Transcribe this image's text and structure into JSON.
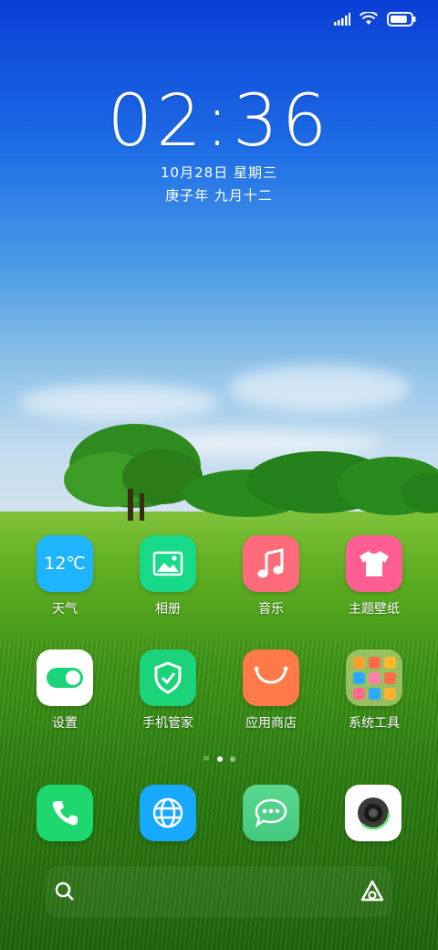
{
  "lockscreen": {
    "time": "02:36",
    "date": "10月28日 星期三",
    "lunar": "庚子年 九月十二"
  },
  "status": {
    "signal_icon": "signal-icon",
    "wifi_icon": "wifi-icon",
    "battery_icon": "battery-icon",
    "battery_level": 0.85
  },
  "apps": [
    {
      "name": "weather",
      "label": "天气",
      "icon_text": "12℃",
      "color": "#1eb4ff"
    },
    {
      "name": "photos",
      "label": "相册",
      "color": "#17d98a"
    },
    {
      "name": "music",
      "label": "音乐",
      "color": "#ff6b7b"
    },
    {
      "name": "themes",
      "label": "主题壁纸",
      "color": "#ff5e95"
    },
    {
      "name": "settings",
      "label": "设置",
      "color": "#ffffff"
    },
    {
      "name": "security",
      "label": "手机管家",
      "color": "#1bd47a"
    },
    {
      "name": "app-store",
      "label": "应用商店",
      "color": "#ff7a48"
    },
    {
      "name": "system-tools",
      "label": "系统工具",
      "color": "#9bc95a"
    }
  ],
  "dock": [
    {
      "name": "phone",
      "color": "#1ed86f"
    },
    {
      "name": "browser",
      "color": "#16a9ff"
    },
    {
      "name": "messages",
      "color": "#4fd38f"
    },
    {
      "name": "camera",
      "color": "#ffffff"
    }
  ],
  "page_indicator": {
    "pages": 2,
    "current": 1
  },
  "bottom": {
    "search_icon": "search-icon",
    "assistant_icon": "assistant-icon"
  }
}
